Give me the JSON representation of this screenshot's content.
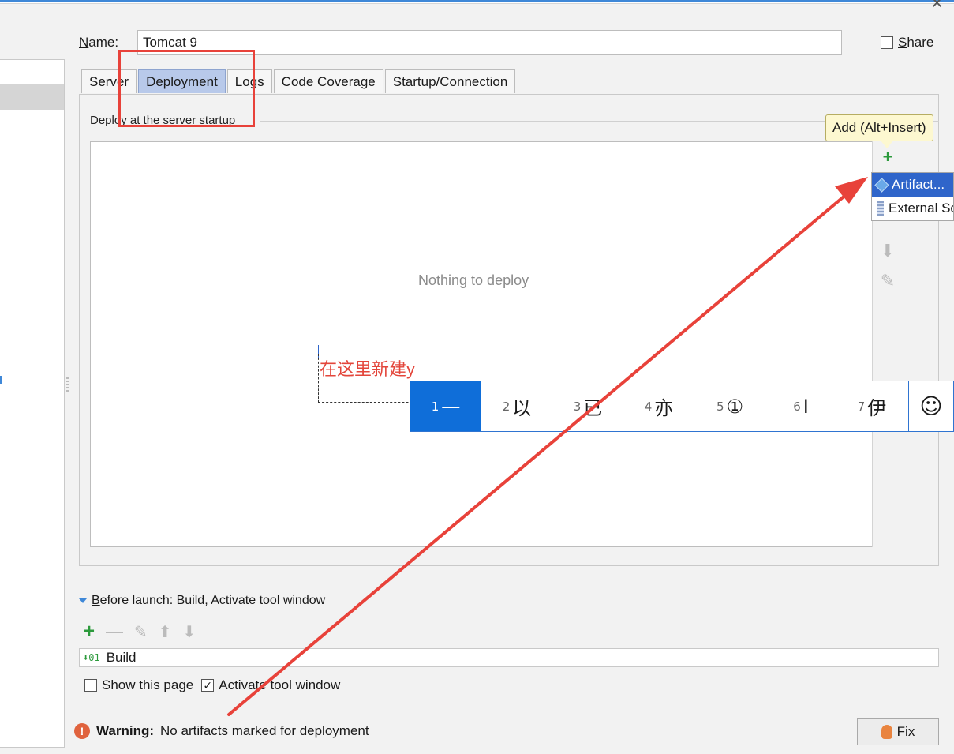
{
  "dialog": {
    "name_label_u": "N",
    "name_label_rest": "ame:",
    "name_value": "Tomcat 9",
    "share_label_u": "S",
    "share_label_rest": "hare",
    "share_checked": false
  },
  "tabs": [
    {
      "label": "Server",
      "active": false
    },
    {
      "label": "Deployment",
      "active": true
    },
    {
      "label": "Logs",
      "active": false
    },
    {
      "label": "Code Coverage",
      "active": false
    },
    {
      "label": "Startup/Connection",
      "active": false
    }
  ],
  "deployment": {
    "group_label": "Deploy at the server startup",
    "empty_text": "Nothing to deploy",
    "tooltip": "Add (Alt+Insert)",
    "add_icon": "+",
    "popup_items": [
      {
        "label": "Artifact...",
        "icon": "artifact-icon",
        "selected": true
      },
      {
        "label": "External Source...",
        "icon": "external-source-icon",
        "selected": false
      }
    ]
  },
  "ime": {
    "composition": "在这里新建y",
    "candidates": [
      {
        "num": "1",
        "text": "一"
      },
      {
        "num": "2",
        "text": "以"
      },
      {
        "num": "3",
        "text": "已"
      },
      {
        "num": "4",
        "text": "亦"
      },
      {
        "num": "5",
        "text": "①"
      },
      {
        "num": "6",
        "text": "I"
      },
      {
        "num": "7",
        "text": "伊"
      }
    ],
    "emoji": "☺"
  },
  "before_launch": {
    "title_u": "B",
    "title_rest": "efore launch: Build, Activate tool window",
    "items": [
      "Build"
    ],
    "show_page_label": "Show this page",
    "show_page_checked": false,
    "activate_label": "Activate tool window",
    "activate_checked": true
  },
  "warning": {
    "bold": "Warning:",
    "message": "No artifacts marked for deployment",
    "fix_label": "Fix"
  },
  "colors": {
    "annotation_red": "#e8423a",
    "ime_selected": "#0f6ed9",
    "popup_selected": "#2f65ca"
  }
}
